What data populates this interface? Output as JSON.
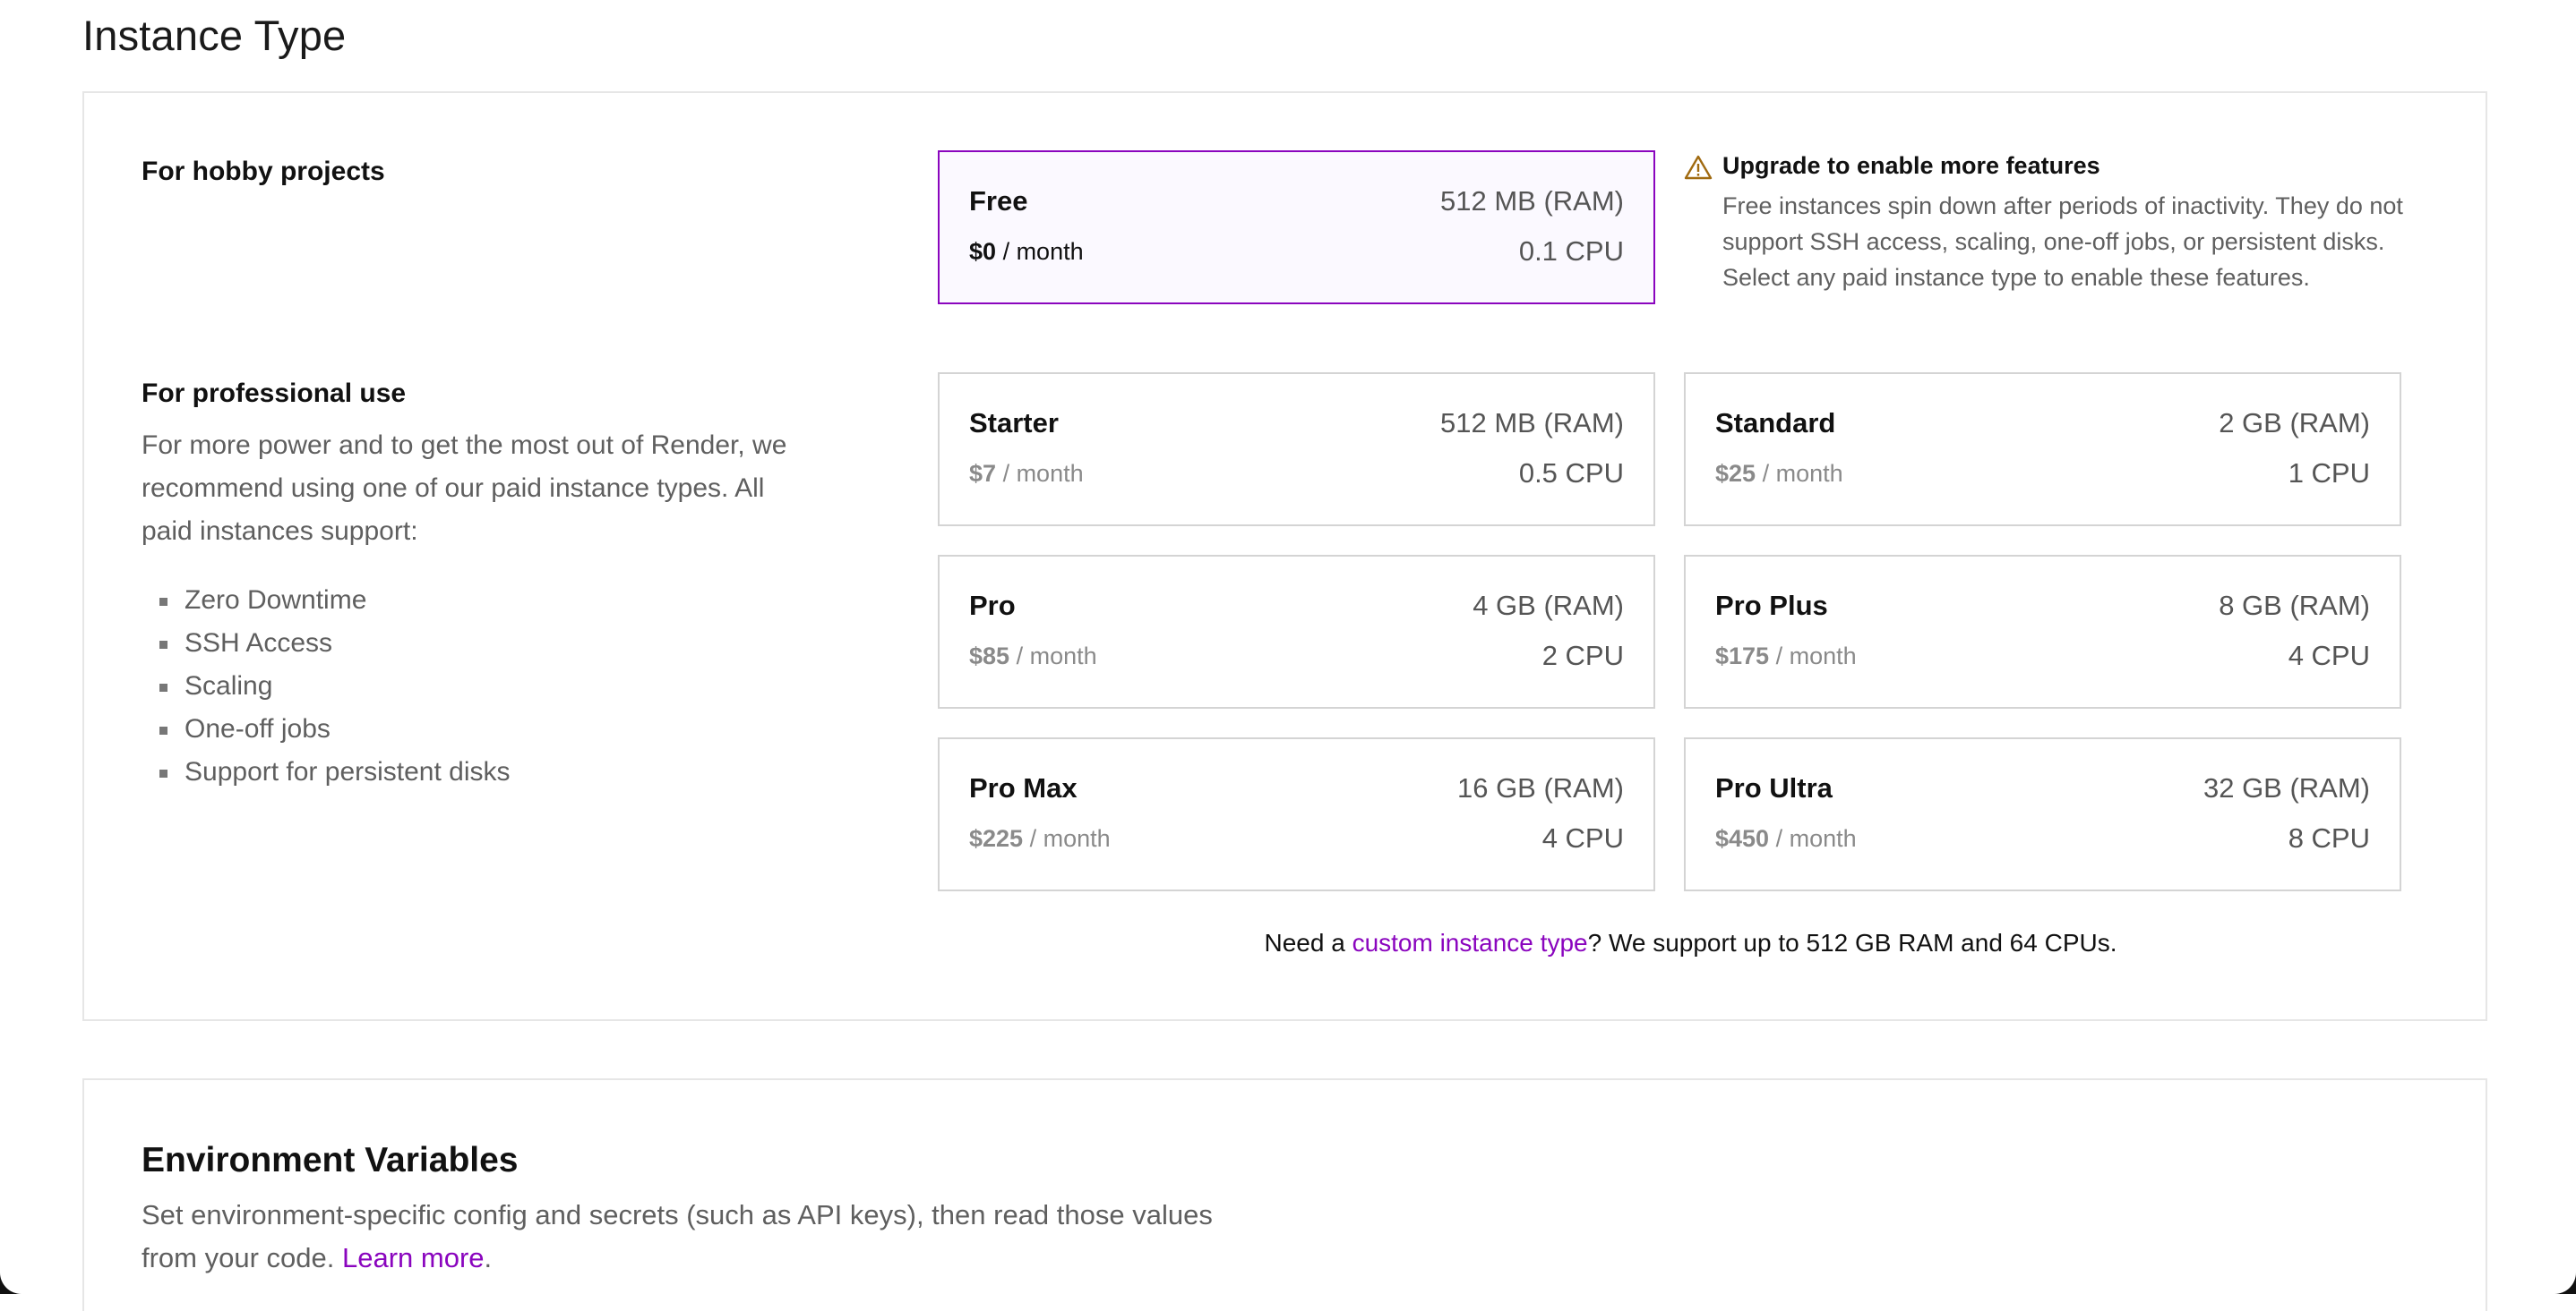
{
  "page": {
    "section_heading": "Instance Type"
  },
  "hobby": {
    "title": "For hobby projects"
  },
  "professional": {
    "title": "For professional use",
    "description": "For more power and to get the most out of Render, we recommend using one of our paid instance types. All paid instances support:",
    "features": [
      "Zero Downtime",
      "SSH Access",
      "Scaling",
      "One-off jobs",
      "Support for persistent disks"
    ]
  },
  "instances": {
    "free": {
      "name": "Free",
      "price": "$0",
      "period": "/ month",
      "ram": "512 MB (RAM)",
      "cpu": "0.1 CPU",
      "selected": true
    },
    "starter": {
      "name": "Starter",
      "price": "$7",
      "period": "/ month",
      "ram": "512 MB (RAM)",
      "cpu": "0.5 CPU"
    },
    "standard": {
      "name": "Standard",
      "price": "$25",
      "period": "/ month",
      "ram": "2 GB (RAM)",
      "cpu": "1 CPU"
    },
    "pro": {
      "name": "Pro",
      "price": "$85",
      "period": "/ month",
      "ram": "4 GB (RAM)",
      "cpu": "2 CPU"
    },
    "pro_plus": {
      "name": "Pro Plus",
      "price": "$175",
      "period": "/ month",
      "ram": "8 GB (RAM)",
      "cpu": "4 CPU"
    },
    "pro_max": {
      "name": "Pro Max",
      "price": "$225",
      "period": "/ month",
      "ram": "16 GB (RAM)",
      "cpu": "4 CPU"
    },
    "pro_ultra": {
      "name": "Pro Ultra",
      "price": "$450",
      "period": "/ month",
      "ram": "32 GB (RAM)",
      "cpu": "8 CPU"
    }
  },
  "upgrade_notice": {
    "icon": "warning-icon",
    "title": "Upgrade to enable more features",
    "text": "Free instances spin down after periods of inactivity. They do not support SSH access, scaling, one-off jobs, or persistent disks. Select any paid instance type to enable these features."
  },
  "custom_note": {
    "prefix": "Need a ",
    "link": "custom instance type",
    "suffix": "? We support up to 512 GB RAM and 64 CPUs."
  },
  "env": {
    "title": "Environment Variables",
    "description": "Set environment-specific config and secrets (such as API keys), then read those values from your code. ",
    "link": "Learn more",
    "suffix": "."
  },
  "colors": {
    "accent": "#8a05be",
    "selected_bg": "#fbf9ff",
    "border": "#d4d4d4",
    "muted_text": "#5f5f5f"
  }
}
